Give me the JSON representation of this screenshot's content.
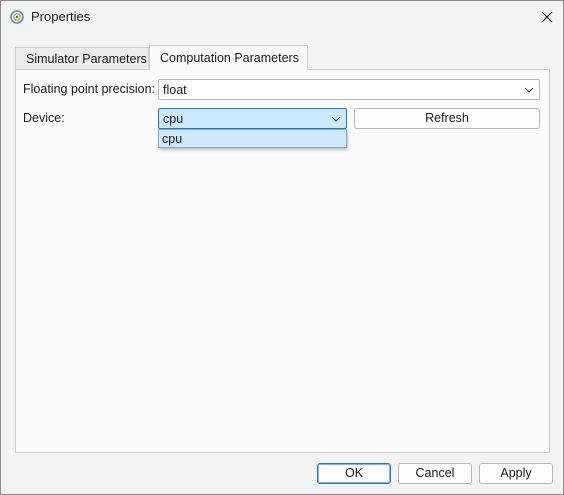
{
  "window": {
    "title": "Properties",
    "app_icon": "qt-style-app-icon",
    "close_icon": "close-icon"
  },
  "tabs": [
    {
      "label": "Simulator Parameters",
      "selected": false
    },
    {
      "label": "Computation Parameters",
      "selected": true
    }
  ],
  "form": {
    "precision_label": "Floating point precision:",
    "precision_value": "float",
    "device_label": "Device:",
    "device_value": "cpu",
    "device_dropdown_open": true,
    "device_options": [
      "cpu"
    ],
    "refresh_label": "Refresh"
  },
  "buttons": {
    "ok": "OK",
    "cancel": "Cancel",
    "apply": "Apply"
  },
  "colors": {
    "selected_highlight": "#cce8ff",
    "focus_border": "#1979ca",
    "default_button_border": "#2a75c8"
  }
}
